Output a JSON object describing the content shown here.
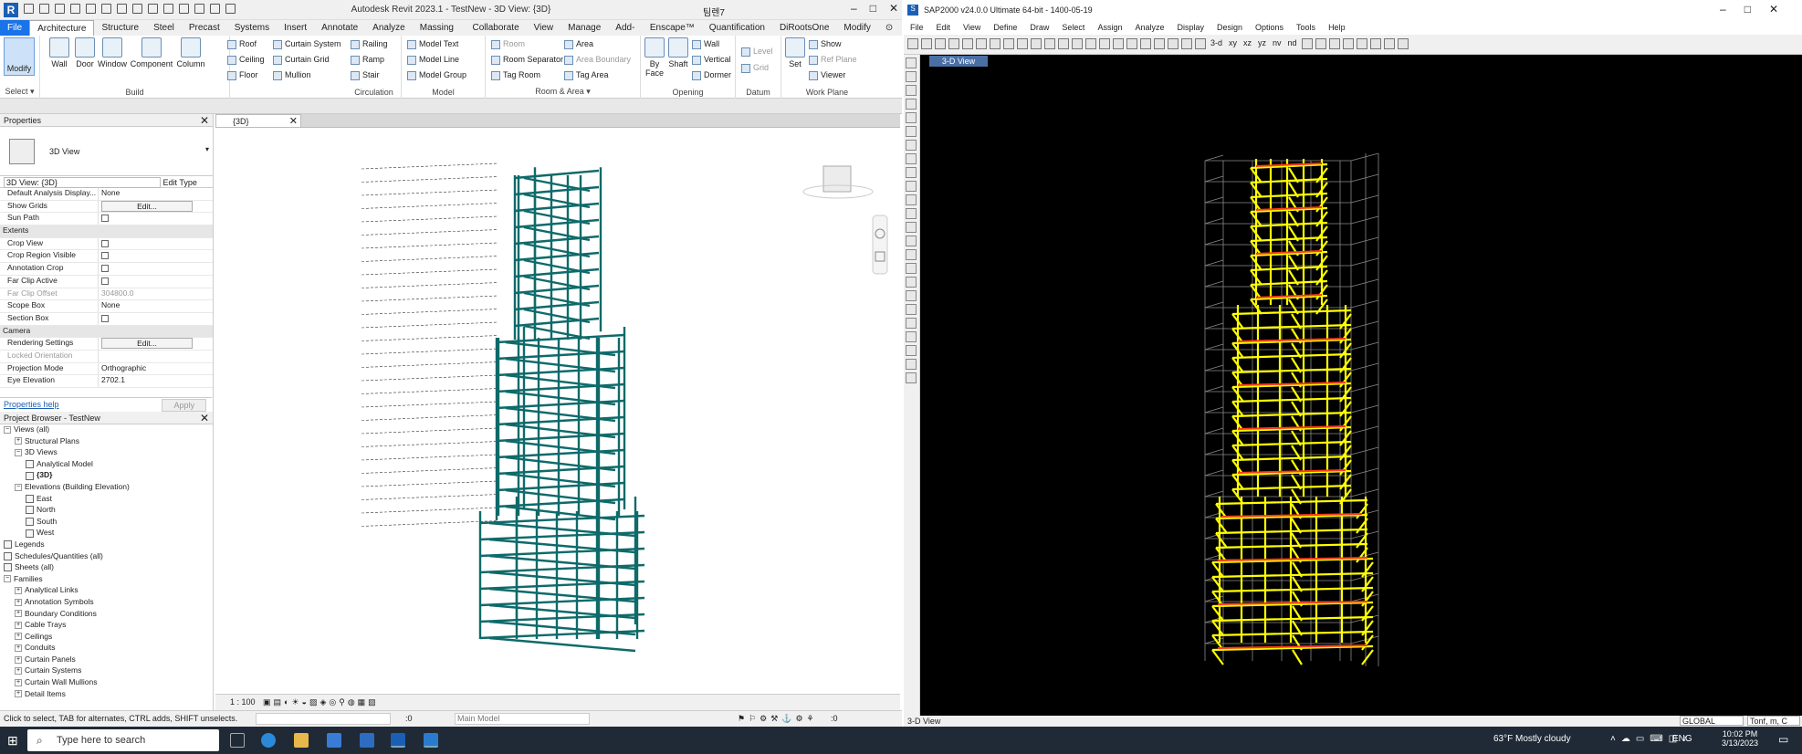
{
  "revit": {
    "title": "Autodesk Revit 2023.1 - TestNew - 3D View: {3D}",
    "user": "팀렌7",
    "tabs": [
      "File",
      "Architecture",
      "Structure",
      "Steel",
      "Precast",
      "Systems",
      "Insert",
      "Annotate",
      "Analyze",
      "Massing & Site",
      "Collaborate",
      "View",
      "Manage",
      "Add-Ins",
      "Enscape™",
      "Quantification",
      "DiRootsOne",
      "Modify"
    ],
    "ribbon": {
      "modify": "Modify",
      "select": "Select ▾",
      "build_label": "Build",
      "build_big": [
        "Wall",
        "Door",
        "Window",
        "Component",
        "Column"
      ],
      "build_small": [
        "Roof",
        "Ceiling",
        "Floor",
        "Curtain System",
        "Curtain Grid",
        "Mullion"
      ],
      "circulation_label": "Circulation",
      "circulation": [
        "Railing",
        "Ramp",
        "Stair"
      ],
      "model_label": "Model",
      "model": [
        "Model Text",
        "Model Line",
        "Model Group"
      ],
      "room_label": "Room & Area ▾",
      "room": [
        "Room",
        "Room Separator",
        "Tag Room",
        "Area",
        "Area Boundary",
        "Tag Area"
      ],
      "opening_label": "Opening",
      "opening": [
        "By Face",
        "Shaft",
        "Wall",
        "Vertical",
        "Dormer"
      ],
      "datum_label": "Datum",
      "datum": [
        "Level",
        "Grid"
      ],
      "workplane_label": "Work Plane",
      "workplane": [
        "Set",
        "Show",
        "Ref Plane",
        "Viewer"
      ]
    },
    "properties": {
      "header": "Properties",
      "type_name": "3D View",
      "selector": "3D View: {3D}",
      "edit_type": "Edit Type",
      "rows": [
        {
          "k": "Default Analysis Display...",
          "v": "None",
          "kind": "text"
        },
        {
          "k": "Show Grids",
          "v": "Edit...",
          "kind": "btn"
        },
        {
          "k": "Sun Path",
          "v": "",
          "kind": "chk"
        },
        {
          "k": "Extents",
          "v": "",
          "kind": "sec"
        },
        {
          "k": "Crop View",
          "v": "",
          "kind": "chk"
        },
        {
          "k": "Crop Region Visible",
          "v": "",
          "kind": "chk"
        },
        {
          "k": "Annotation Crop",
          "v": "",
          "kind": "chk"
        },
        {
          "k": "Far Clip Active",
          "v": "",
          "kind": "chk"
        },
        {
          "k": "Far Clip Offset",
          "v": "304800.0",
          "kind": "dis"
        },
        {
          "k": "Scope Box",
          "v": "None",
          "kind": "text"
        },
        {
          "k": "Section Box",
          "v": "",
          "kind": "chk"
        },
        {
          "k": "Camera",
          "v": "",
          "kind": "sec"
        },
        {
          "k": "Rendering Settings",
          "v": "Edit...",
          "kind": "btn"
        },
        {
          "k": "Locked Orientation",
          "v": "",
          "kind": "dis"
        },
        {
          "k": "Projection Mode",
          "v": "Orthographic",
          "kind": "text"
        },
        {
          "k": "Eye Elevation",
          "v": "2702.1",
          "kind": "text"
        }
      ],
      "help": "Properties help",
      "apply": "Apply"
    },
    "browser": {
      "header": "Project Browser - TestNew",
      "nodes": [
        {
          "t": "Views (all)",
          "d": 0,
          "ex": "−"
        },
        {
          "t": "Structural Plans",
          "d": 1,
          "ex": "+"
        },
        {
          "t": "3D Views",
          "d": 1,
          "ex": "−"
        },
        {
          "t": "Analytical Model",
          "d": 2,
          "ex": "v"
        },
        {
          "t": "{3D}",
          "d": 2,
          "ex": "v",
          "bold": true
        },
        {
          "t": "Elevations (Building Elevation)",
          "d": 1,
          "ex": "−"
        },
        {
          "t": "East",
          "d": 2,
          "ex": "v"
        },
        {
          "t": "North",
          "d": 2,
          "ex": "v"
        },
        {
          "t": "South",
          "d": 2,
          "ex": "v"
        },
        {
          "t": "West",
          "d": 2,
          "ex": "v"
        },
        {
          "t": "Legends",
          "d": 0,
          "ex": "v"
        },
        {
          "t": "Schedules/Quantities (all)",
          "d": 0,
          "ex": "v"
        },
        {
          "t": "Sheets (all)",
          "d": 0,
          "ex": "v"
        },
        {
          "t": "Families",
          "d": 0,
          "ex": "−"
        },
        {
          "t": "Analytical Links",
          "d": 1,
          "ex": "+"
        },
        {
          "t": "Annotation Symbols",
          "d": 1,
          "ex": "+"
        },
        {
          "t": "Boundary Conditions",
          "d": 1,
          "ex": "+"
        },
        {
          "t": "Cable Trays",
          "d": 1,
          "ex": "+"
        },
        {
          "t": "Ceilings",
          "d": 1,
          "ex": "+"
        },
        {
          "t": "Conduits",
          "d": 1,
          "ex": "+"
        },
        {
          "t": "Curtain Panels",
          "d": 1,
          "ex": "+"
        },
        {
          "t": "Curtain Systems",
          "d": 1,
          "ex": "+"
        },
        {
          "t": "Curtain Wall Mullions",
          "d": 1,
          "ex": "+"
        },
        {
          "t": "Detail Items",
          "d": 1,
          "ex": "+"
        }
      ]
    },
    "view_tab": "{3D}",
    "scale": "1 : 100",
    "status": "Click to select, TAB for alternates, CTRL adds, SHIFT unselects.",
    "workset": ":0",
    "main_model": "Main Model",
    "filter_count": ":0"
  },
  "sap": {
    "title": "SAP2000 v24.0.0 Ultimate 64-bit - 1400-05-19",
    "menu": [
      "File",
      "Edit",
      "View",
      "Define",
      "Draw",
      "Select",
      "Assign",
      "Analyze",
      "Display",
      "Design",
      "Options",
      "Tools",
      "Help"
    ],
    "toolbar_text": [
      "3-d",
      "xy",
      "xz",
      "yz",
      "nv",
      "nd"
    ],
    "view_tab": "3-D View",
    "status_left": "3-D View",
    "coord": "GLOBAL",
    "units": "Tonf, m, C"
  },
  "taskbar": {
    "search": "Type here to search",
    "weather": "63°F  Mostly cloudy",
    "lang": "ENG",
    "time": "10:02 PM",
    "date": "3/13/2023"
  },
  "colors": {
    "revit_steel": "#0f6a6a",
    "sap_frame": "#ffff00",
    "sap_red": "#ff3b1a",
    "sap_grid": "#8a8a8a"
  }
}
